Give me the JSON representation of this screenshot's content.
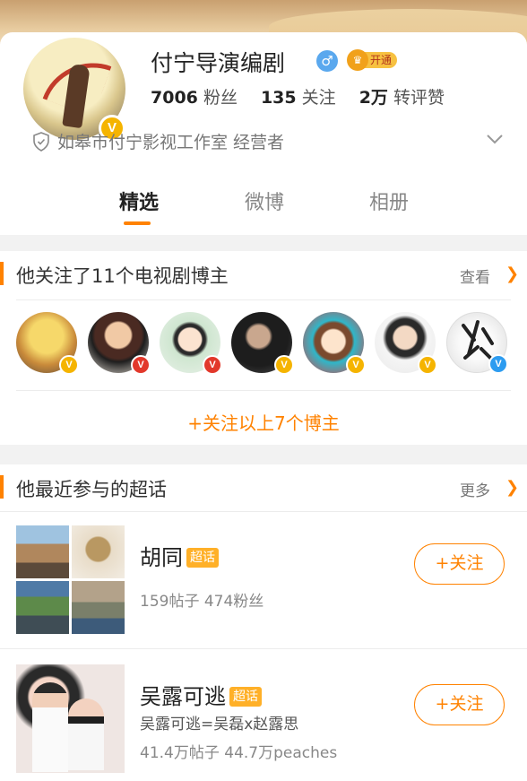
{
  "profile": {
    "name": "付宁导演编剧",
    "gender_symbol": "♂",
    "vip_label": "开通",
    "stats": {
      "fans_count": "7006",
      "fans_label": "粉丝",
      "following_count": "135",
      "following_label": "关注",
      "likes_count": "2万",
      "likes_label": "转评赞"
    },
    "verification": "如皋市付宁影视工作室 经营者"
  },
  "tabs": [
    "精选",
    "微博",
    "相册"
  ],
  "following_section": {
    "title": "他关注了11个电视剧博主",
    "more_label": "查看",
    "follow_all_label": "+关注以上7个博主",
    "avatars": [
      {
        "badge_color": "#f5b400",
        "icon": "film-set-avatar"
      },
      {
        "badge_color": "#e2382b",
        "icon": "woman-avatar"
      },
      {
        "badge_color": "#e2382b",
        "icon": "illustrated-girl-avatar"
      },
      {
        "badge_color": "#f5b400",
        "icon": "man-glasses-avatar"
      },
      {
        "badge_color": "#f5b400",
        "icon": "cartoon-boy-avatar"
      },
      {
        "badge_color": "#f5b400",
        "icon": "young-man-avatar"
      },
      {
        "badge_color": "#2d9cf0",
        "icon": "calligraphy-avatar"
      }
    ]
  },
  "topics_section": {
    "title": "他最近参与的超话",
    "more_label": "更多",
    "items": [
      {
        "title": "胡同",
        "tag": "超话",
        "desc": "",
        "stats": "159帖子 474粉丝",
        "follow_label": "+关注"
      },
      {
        "title": "吴露可逃",
        "tag": "超话",
        "desc": "吴露可逃=吴磊x赵露思",
        "stats": "41.4万帖子 44.7万peaches",
        "follow_label": "+关注"
      }
    ]
  },
  "colors": {
    "accent": "#ff8200",
    "verified_gold": "#f5b400",
    "tag": "#ffb028"
  }
}
